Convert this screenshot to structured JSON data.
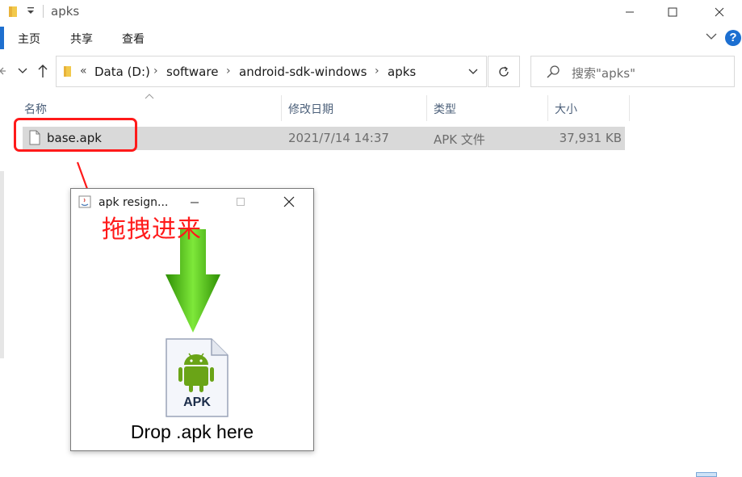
{
  "window": {
    "title": "apks",
    "folder_icon": "folder-icon"
  },
  "ribbon": {
    "tabs": [
      "主页",
      "共享",
      "查看"
    ],
    "help_label": "?"
  },
  "address_bar": {
    "overflow": "«",
    "crumbs": [
      "Data (D:)",
      "software",
      "android-sdk-windows",
      "apks"
    ],
    "separator": "›"
  },
  "search": {
    "placeholder": "搜索\"apks\""
  },
  "columns": {
    "name": "名称",
    "modified": "修改日期",
    "type": "类型",
    "size": "大小"
  },
  "files": [
    {
      "name": "base.apk",
      "modified": "2021/7/14 14:37",
      "type": "APK 文件",
      "size": "37,931 KB"
    }
  ],
  "annotation": {
    "text": "拖拽进来",
    "color": "#ff1a1a"
  },
  "dialog": {
    "title": "apk resign...",
    "drop_label": "Drop .apk here",
    "apk_badge": "APK"
  },
  "colors": {
    "accent": "#1e6fcf",
    "selection": "#d9d9d9",
    "arrow_green": "#55c21a",
    "android_green": "#6aa417"
  }
}
